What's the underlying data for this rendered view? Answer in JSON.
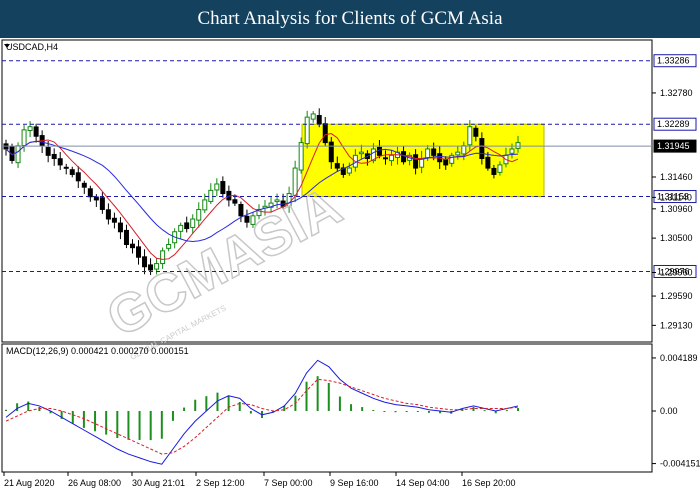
{
  "header": {
    "title": "Chart Analysis for Clients of GCM Asia"
  },
  "main_panel": {
    "symbol_label": "USDCAD,H4",
    "price_axis": [
      "1.32780",
      "1.31460",
      "1.31140",
      "1.30960",
      "1.30500",
      "1.29960",
      "1.29590",
      "1.29130"
    ],
    "levels": [
      {
        "label": "1.33286",
        "value": 1.33286
      },
      {
        "label": "1.32289",
        "value": 1.32289
      },
      {
        "label": "1.31153",
        "value": 1.31153
      },
      {
        "label": "1.29976",
        "value": 1.29976
      }
    ],
    "current_price": {
      "label": "1.31945",
      "value": 1.31945
    },
    "range_box": {
      "top": 1.32289,
      "bottom": 1.31153,
      "color": "#ffff00"
    },
    "watermark": "GCMASIA",
    "watermark_sub": "GLOBAL CAPITAL MARKETS",
    "colors": {
      "ma_fast": "#d61f2a",
      "ma_slow": "#2a2ae0",
      "level_line": "#1a1aa8",
      "bull": "#118811",
      "bear": "#000000"
    }
  },
  "macd_panel": {
    "label": "MACD(12,26,9) 0.000421 0.000270 0.000151",
    "axis": [
      "0.004189",
      "0.00",
      "-0.004151"
    ],
    "colors": {
      "histogram": "#1e8f1e",
      "macd": "#1a1ae0",
      "signal": "#d61f2a"
    }
  },
  "time_axis": [
    "21 Aug 2020",
    "26 Aug 08:00",
    "30 Aug 21:01",
    "2 Sep 12:00",
    "7 Sep 00:00",
    "9 Sep 16:00",
    "14 Sep 04:00",
    "16 Sep 20:00"
  ],
  "chart_data": {
    "type": "candlestick",
    "symbol": "USDCAD",
    "timeframe": "H4",
    "price_range": [
      1.289,
      1.3358
    ],
    "closes": [
      1.319,
      1.3172,
      1.3195,
      1.322,
      1.3225,
      1.321,
      1.3195,
      1.318,
      1.3175,
      1.3165,
      1.316,
      1.315,
      1.314,
      1.313,
      1.3115,
      1.311,
      1.3095,
      1.308,
      1.3075,
      1.306,
      1.304,
      1.3035,
      1.302,
      1.3005,
      1.3,
      1.301,
      1.303,
      1.304,
      1.306,
      1.307,
      1.3065,
      1.308,
      1.3095,
      1.311,
      1.3125,
      1.3135,
      1.312,
      1.311,
      1.3105,
      1.3085,
      1.3075,
      1.3085,
      1.3095,
      1.31,
      1.3105,
      1.311,
      1.31,
      1.312,
      1.316,
      1.32,
      1.324,
      1.3245,
      1.323,
      1.32,
      1.317,
      1.316,
      1.315,
      1.316,
      1.318,
      1.3185,
      1.3175,
      1.319,
      1.318,
      1.3175,
      1.318,
      1.3185,
      1.317,
      1.318,
      1.316,
      1.3175,
      1.319,
      1.318,
      1.317,
      1.3165,
      1.318,
      1.3185,
      1.3195,
      1.3225,
      1.321,
      1.3175,
      1.316,
      1.315,
      1.3165,
      1.318,
      1.319,
      1.32
    ],
    "macd": [
      -0.0005,
      0.0002,
      0.0006,
      0.0004,
      0.0,
      -0.0005,
      -0.001,
      -0.0015,
      -0.002,
      -0.0025,
      -0.003,
      -0.0034,
      -0.0037,
      -0.004,
      -0.0042,
      -0.003,
      -0.0018,
      -0.0008,
      0.0,
      0.0008,
      0.0012,
      0.001,
      0.0002,
      -0.0003,
      -0.0001,
      0.0004,
      0.0014,
      0.003,
      0.004,
      0.0035,
      0.0025,
      0.0018,
      0.0014,
      0.001,
      0.0007,
      0.0005,
      0.0004,
      0.0003,
      0.0001,
      0.0,
      -0.0001,
      0.0002,
      0.0004,
      0.0002,
      0.0,
      0.0002,
      0.0004
    ],
    "signal": [
      -0.0008,
      -0.0004,
      0.0,
      0.0002,
      0.0002,
      0.0,
      -0.0003,
      -0.0006,
      -0.001,
      -0.0014,
      -0.0018,
      -0.0022,
      -0.0026,
      -0.003,
      -0.0034,
      -0.0033,
      -0.0028,
      -0.0021,
      -0.0013,
      -0.0005,
      0.0003,
      0.0006,
      0.0005,
      0.0002,
      0.0,
      0.0001,
      0.0006,
      0.0016,
      0.0025,
      0.0024,
      0.0022,
      0.0019,
      0.0016,
      0.0013,
      0.001,
      0.0008,
      0.0006,
      0.0005,
      0.0003,
      0.0002,
      0.0001,
      0.0001,
      0.0002,
      0.0002,
      0.0002,
      0.0002,
      0.0003
    ]
  }
}
